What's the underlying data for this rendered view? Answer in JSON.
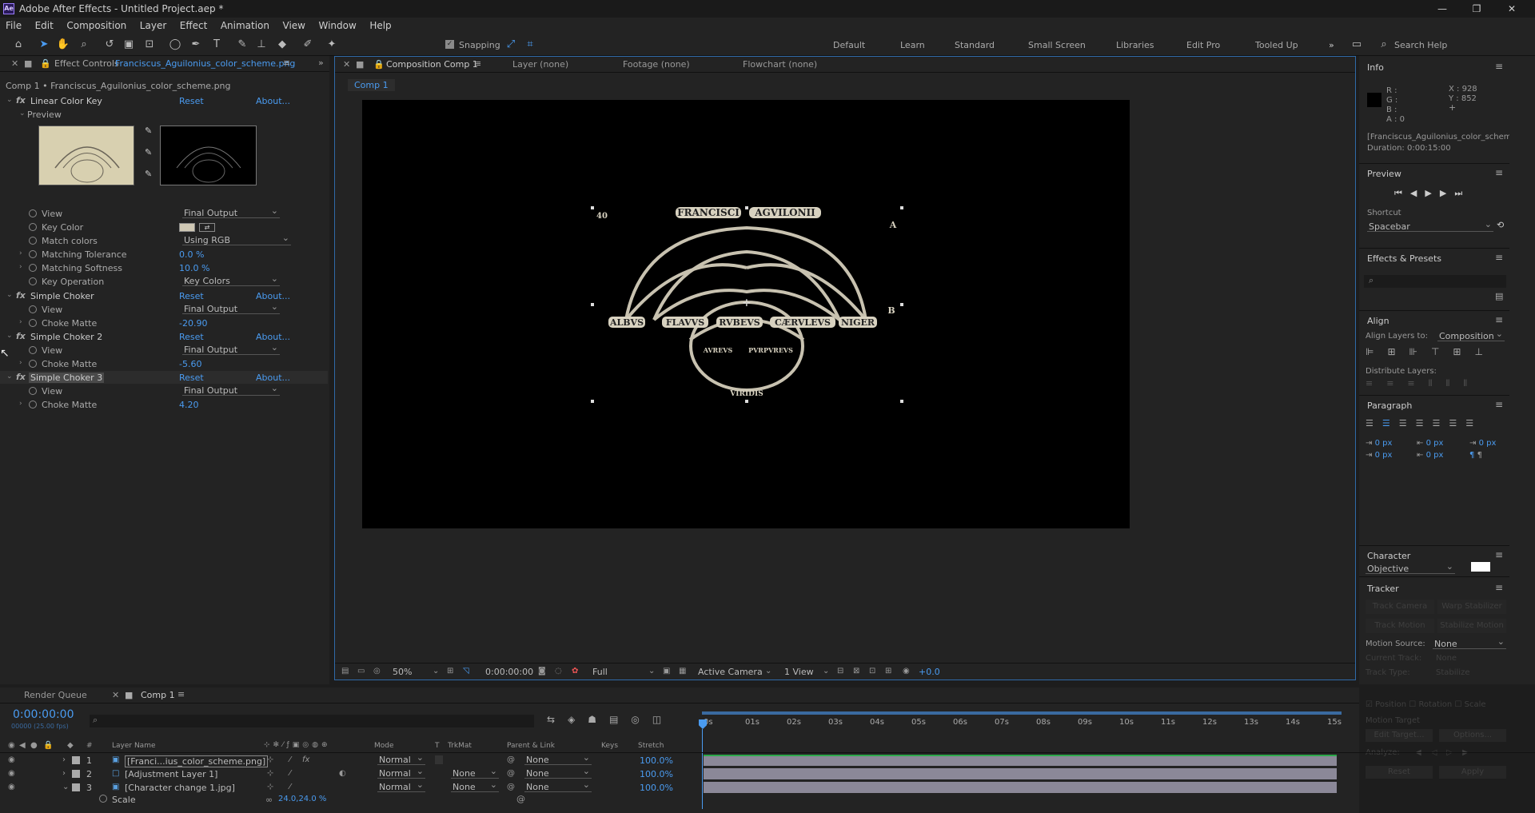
{
  "window": {
    "title": "Adobe After Effects - Untitled Project.aep *",
    "logo": "Ae"
  },
  "menu": [
    "File",
    "Edit",
    "Composition",
    "Layer",
    "Effect",
    "Animation",
    "View",
    "Window",
    "Help"
  ],
  "toolbar": {
    "snapping": "Snapping",
    "search_placeholder": "Search Help"
  },
  "workspaces": [
    "Default",
    "Learn",
    "Standard",
    "Small Screen",
    "Libraries",
    "Edit Pro",
    "Tooled Up"
  ],
  "effect_controls": {
    "tab_prefix": "Effect Controls",
    "tab_file": "Franciscus_Aguilonius_color_scheme.png",
    "subtitle": "Comp 1 • Franciscus_Aguilonius_color_scheme.png",
    "linear": {
      "name": "Linear Color Key",
      "reset": "Reset",
      "about": "About...",
      "preview": "Preview",
      "props": [
        {
          "label": "View",
          "value": "Final Output"
        },
        {
          "label": "Key Color",
          "value": ""
        },
        {
          "label": "Match colors",
          "value": "Using RGB"
        },
        {
          "label": "Matching Tolerance",
          "value": "0.0 %"
        },
        {
          "label": "Matching Softness",
          "value": "10.0 %"
        },
        {
          "label": "Key Operation",
          "value": "Key Colors"
        }
      ]
    },
    "chokers": [
      {
        "name": "Simple Choker",
        "reset": "Reset",
        "about": "About...",
        "view": "Final Output",
        "choke_label": "Choke Matte",
        "choke": "-20.90"
      },
      {
        "name": "Simple Choker 2",
        "reset": "Reset",
        "about": "About...",
        "view": "Final Output",
        "choke_label": "Choke Matte",
        "choke": "-5.60"
      },
      {
        "name": "Simple Choker 3",
        "reset": "Reset",
        "about": "About...",
        "view": "Final Output",
        "choke_label": "Choke Matte",
        "choke": "4.20"
      }
    ],
    "view_label": "View"
  },
  "composition": {
    "tabs": {
      "comp": "Composition Comp 1",
      "layer": "Layer (none)",
      "footage": "Footage (none)",
      "flowchart": "Flowchart (none)"
    },
    "crumb": "Comp 1",
    "artwork": {
      "top1": "FRANCISCI",
      "top2": "AGVILONII",
      "bottom": [
        "ALBVS",
        "FLAVVS",
        "RVBEVS",
        "CÆRVLEVS",
        "NIGER"
      ],
      "inner1": "AVREVS",
      "inner2": "PVRPVREVS",
      "low": "VIRIDIS",
      "a": "A",
      "b": "B",
      "n": "40"
    },
    "footer": {
      "zoom": "50%",
      "time": "0:00:00:00",
      "res": "Full",
      "camera": "Active Camera",
      "views": "1 View",
      "exposure": "+0.0"
    }
  },
  "info": {
    "title": "Info",
    "r": "R :",
    "g": "G :",
    "b": "B :",
    "a": "A :  0",
    "x": "X : 928",
    "y": "Y : 852",
    "file": "[Franciscus_Aguilonius_color_scheme.png]",
    "duration": "Duration: 0:00:15:00"
  },
  "preview_panel": {
    "title": "Preview",
    "shortcut_label": "Shortcut",
    "shortcut": "Spacebar"
  },
  "effects_presets": {
    "title": "Effects & Presets"
  },
  "align": {
    "title": "Align",
    "to_label": "Align Layers to:",
    "to": "Composition",
    "distribute": "Distribute Layers:"
  },
  "paragraph": {
    "title": "Paragraph",
    "px": "0 px"
  },
  "character": {
    "title": "Character",
    "font": "Objective"
  },
  "tracker": {
    "title": "Tracker",
    "track_camera": "Track Camera",
    "warp": "Warp Stabilizer",
    "track_motion": "Track Motion",
    "stabilize": "Stabilize Motion",
    "motion_source_label": "Motion Source:",
    "motion_source": "None",
    "current_track_label": "Current Track:",
    "current_track": "None",
    "track_type_label": "Track Type:",
    "track_type": "Stabilize",
    "position": "Position",
    "rotation": "Rotation",
    "scale": "Scale",
    "motion_target": "Motion Target",
    "edit_target": "Edit Target...",
    "options": "Options...",
    "analyze": "Analyze:",
    "reset": "Reset",
    "apply": "Apply"
  },
  "timeline": {
    "tabs": {
      "render": "Render Queue",
      "comp": "Comp 1"
    },
    "timecode": "0:00:00:00",
    "fps": "00000 (25.00 fps)",
    "headers": {
      "layer_name": "Layer Name",
      "mode": "Mode",
      "t": "T",
      "trkmat": "TrkMat",
      "parent": "Parent & Link",
      "keys": "Keys",
      "stretch": "Stretch"
    },
    "ruler": [
      "0s",
      "01s",
      "02s",
      "03s",
      "04s",
      "05s",
      "06s",
      "07s",
      "08s",
      "09s",
      "10s",
      "11s",
      "12s",
      "13s",
      "14s",
      "15s"
    ],
    "layers": [
      {
        "num": "1",
        "name": "[Franci...ius_color_scheme.png]",
        "mode": "Normal",
        "trkmat": "",
        "parent": "None",
        "stretch": "100.0%"
      },
      {
        "num": "2",
        "name": "[Adjustment Layer 1]",
        "mode": "Normal",
        "trkmat": "None",
        "parent": "None",
        "stretch": "100.0%"
      },
      {
        "num": "3",
        "name": "[Character change 1.jpg]",
        "mode": "Normal",
        "trkmat": "None",
        "parent": "None",
        "stretch": "100.0%"
      }
    ],
    "scale_label": "Scale",
    "scale_value": "24.0,24.0 %"
  }
}
